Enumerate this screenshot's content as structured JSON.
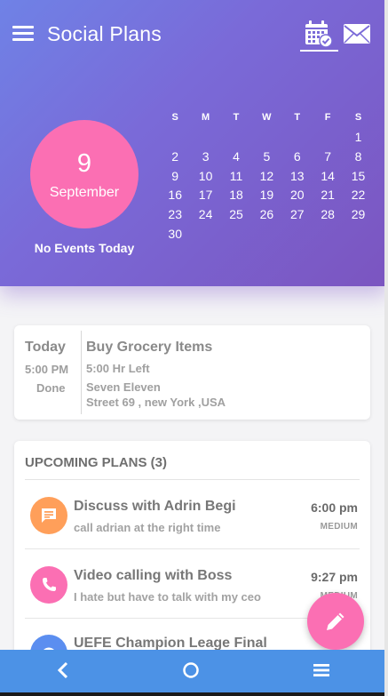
{
  "header": {
    "title": "Social Plans",
    "menu_icon": "hamburger-menu-icon",
    "calendar_icon": "calendar-check-icon",
    "mail_icon": "envelope-icon"
  },
  "selected_date": {
    "day": "9",
    "month": "September",
    "events_text": "No Events Today"
  },
  "calendar": {
    "weekdays": [
      "S",
      "M",
      "T",
      "W",
      "T",
      "F",
      "S"
    ],
    "weeks": [
      [
        "",
        "",
        "",
        "",
        "",
        "",
        "1"
      ],
      [
        "2",
        "3",
        "4",
        "5",
        "6",
        "7",
        "8"
      ],
      [
        "9",
        "10",
        "11",
        "12",
        "13",
        "14",
        "15"
      ],
      [
        "16",
        "17",
        "18",
        "19",
        "20",
        "21",
        "22"
      ],
      [
        "23",
        "24",
        "25",
        "26",
        "27",
        "28",
        "29"
      ],
      [
        "30",
        "",
        "",
        "",
        "",
        "",
        ""
      ]
    ]
  },
  "today": {
    "label": "Today",
    "time": "5:00 PM",
    "status": "Done",
    "title": "Buy Grocery Items",
    "remaining": "5:00 Hr Left",
    "place": "Seven Eleven",
    "address": "Street 69 , new York ,USA"
  },
  "upcoming": {
    "heading": "UPCOMING PLANS (3)",
    "plans": [
      {
        "title": "Discuss with Adrin Begi",
        "note": "call adrian at the right time",
        "time": "6:00 pm",
        "priority": "MEDIUM",
        "icon": "message-icon",
        "color": "#ff9f5a"
      },
      {
        "title": "Video calling with Boss",
        "note": "I hate but have to talk with my ceo",
        "time": "9:27 pm",
        "priority": "MEDIUM",
        "icon": "phone-icon",
        "color": "#fb6fb3"
      },
      {
        "title": "UEFE Champion Leage Final",
        "note": "",
        "time": "",
        "priority": "",
        "icon": "eye-icon",
        "color": "#5b8ef0"
      }
    ]
  },
  "fab": {
    "icon": "pencil-icon",
    "color": "#fb6fb3"
  },
  "navbar": {
    "back_icon": "back-chevron-icon",
    "home_icon": "home-circle-icon",
    "menu_icon": "menu-lines-icon",
    "color": "#4c92e6"
  },
  "colors": {
    "header_start": "#6f82e6",
    "header_end": "#7b55c0",
    "accent_pink": "#fb6fb3"
  }
}
